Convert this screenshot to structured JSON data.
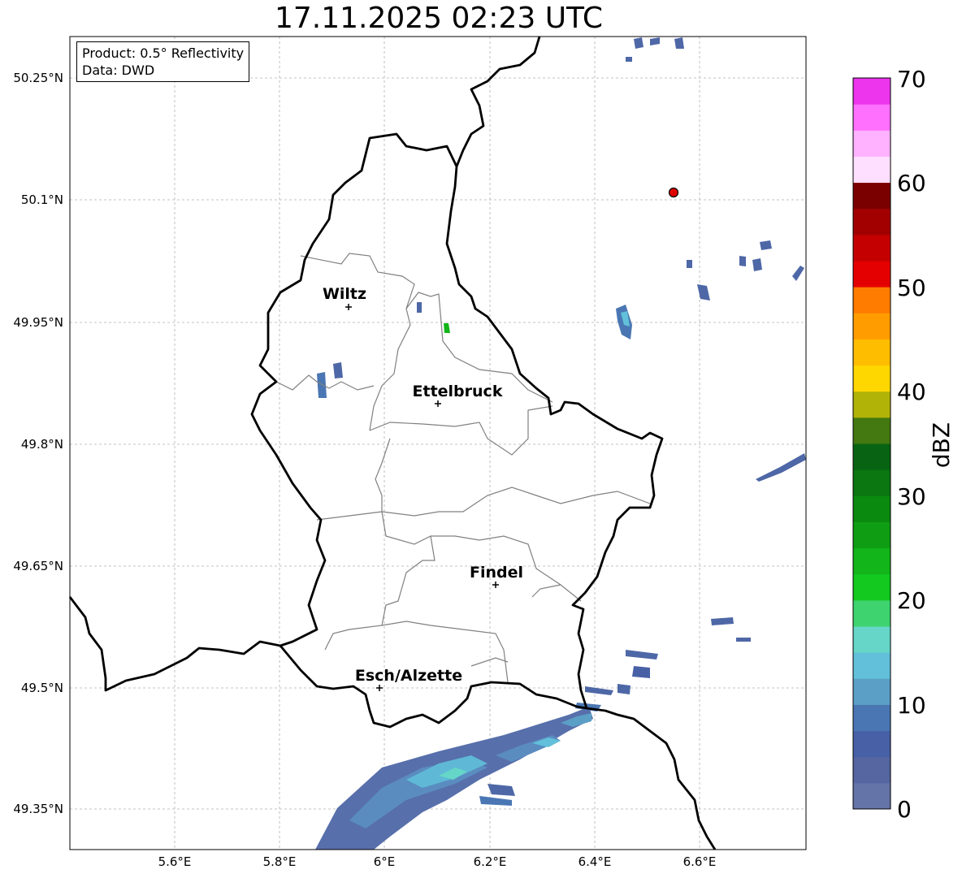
{
  "title": "17.11.2025 02:23 UTC",
  "info": {
    "product": "Product: 0.5° Reflectivity",
    "source": "Data: DWD"
  },
  "lat_ticks": [
    "50.25°N",
    "50.1°N",
    "49.95°N",
    "49.8°N",
    "49.65°N",
    "49.5°N",
    "49.35°N"
  ],
  "lon_ticks": [
    "5.6°E",
    "5.8°E",
    "6°E",
    "6.2°E",
    "6.4°E",
    "6.6°E"
  ],
  "cities": [
    {
      "name": "Wiltz"
    },
    {
      "name": "Ettelbruck"
    },
    {
      "name": "Findel"
    },
    {
      "name": "Esch/Alzette"
    }
  ],
  "colorbar": {
    "label": "dBZ",
    "ticks": [
      "0",
      "10",
      "20",
      "30",
      "40",
      "50",
      "60",
      "70"
    ],
    "colors": [
      "#6574a8",
      "#5566a1",
      "#4861a6",
      "#4a77b3",
      "#5b9fc6",
      "#62c0da",
      "#65d6c8",
      "#3ed36e",
      "#13c81f",
      "#12b51a",
      "#0f9e13",
      "#0b8a10",
      "#0a7711",
      "#086413",
      "#447811",
      "#b1b307",
      "#ffd700",
      "#ffbd00",
      "#ff9d00",
      "#ff7c00",
      "#e40000",
      "#c40000",
      "#a20000",
      "#7a0000",
      "#ffdfff",
      "#ffb2ff",
      "#ff70ff",
      "#ec35ec"
    ]
  }
}
